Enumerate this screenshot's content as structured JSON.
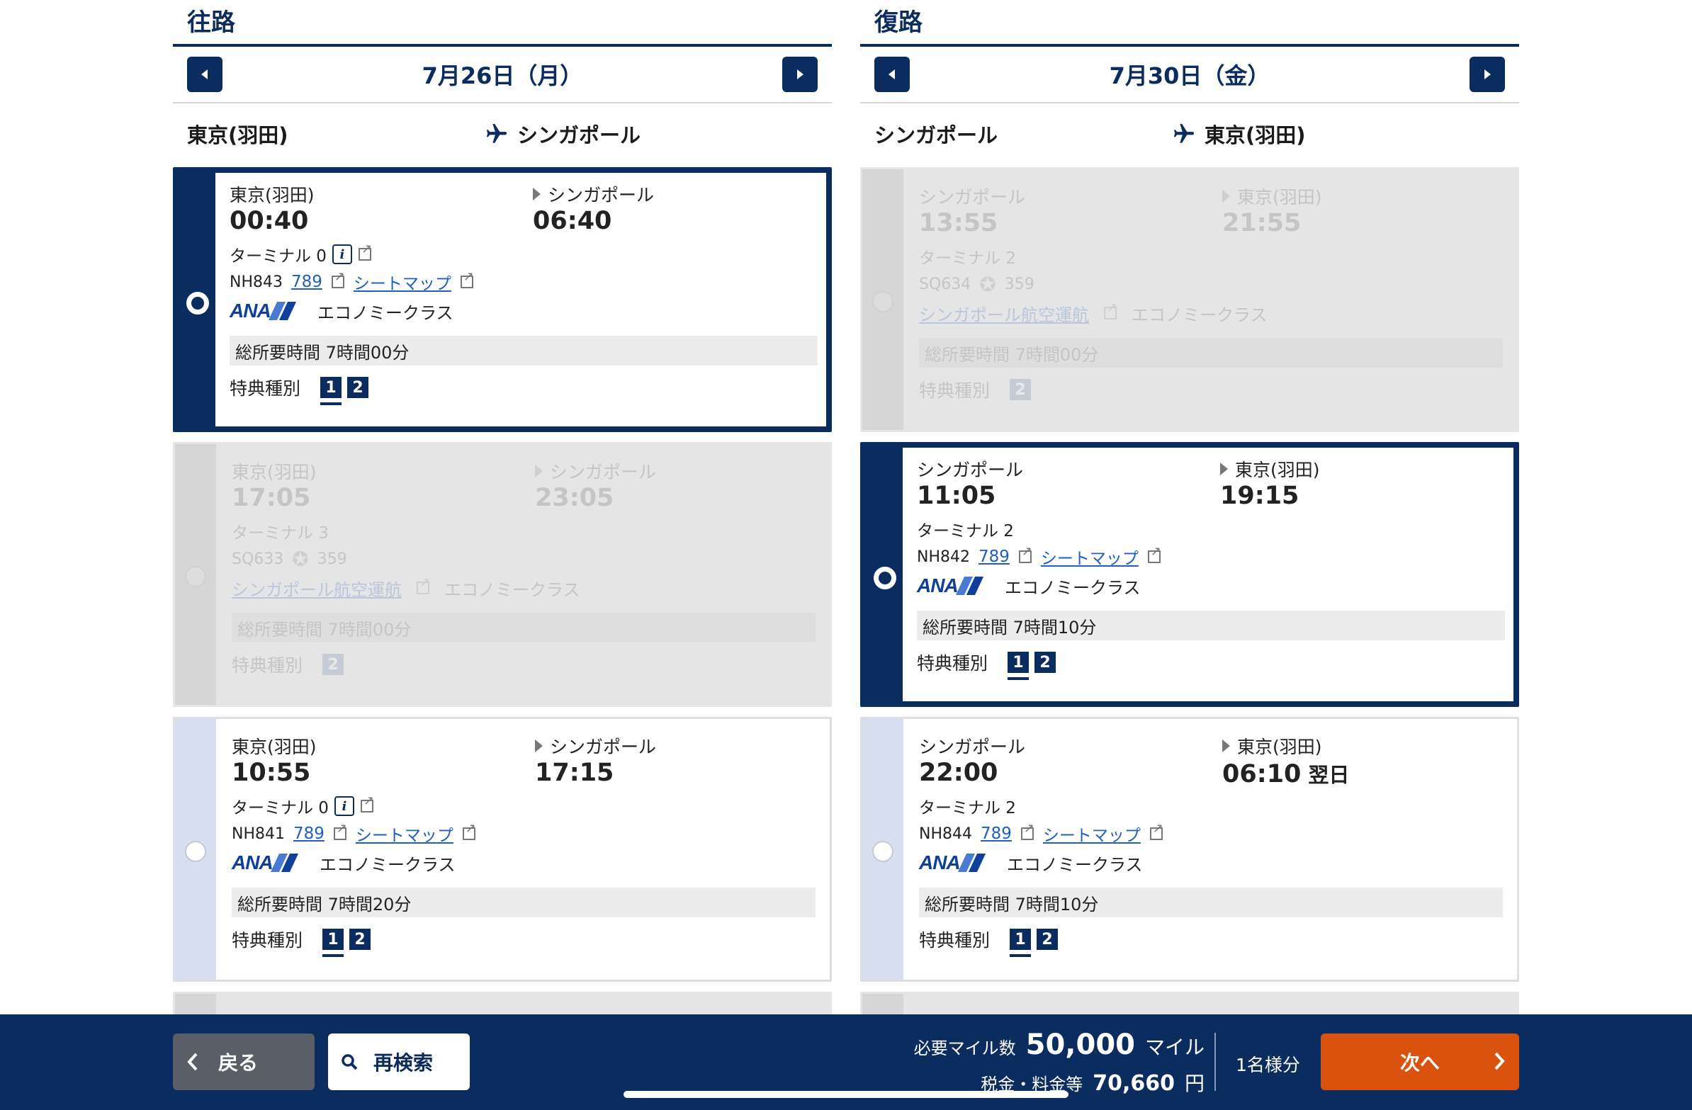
{
  "outbound": {
    "title": "往路",
    "date": "7月26日（月）",
    "from": "東京(羽田)",
    "to": "シンガポール",
    "flights": [
      {
        "dep_city": "東京(羽田)",
        "arr_city": "シンガポール",
        "dep_time": "00:40",
        "arr_time": "06:40",
        "terminal": "ターミナル 0",
        "flight_no": "NH843",
        "aircraft": "789",
        "seat_map": "シートマップ",
        "airline": "ANA",
        "class": "エコノミークラス",
        "duration": "総所要時間 7時間00分",
        "award_label": "特典種別",
        "awards": [
          "1",
          "2"
        ],
        "state": "selected"
      },
      {
        "dep_city": "東京(羽田)",
        "arr_city": "シンガポール",
        "dep_time": "17:05",
        "arr_time": "23:05",
        "terminal": "ターミナル 3",
        "flight_no": "SQ633",
        "aircraft": "359",
        "airline_link": "シンガポール航空運航",
        "class": "エコノミークラス",
        "duration": "総所要時間 7時間00分",
        "award_label": "特典種別",
        "awards": [
          "2"
        ],
        "state": "disabled"
      },
      {
        "dep_city": "東京(羽田)",
        "arr_city": "シンガポール",
        "dep_time": "10:55",
        "arr_time": "17:15",
        "terminal": "ターミナル 0",
        "flight_no": "NH841",
        "aircraft": "789",
        "seat_map": "シートマップ",
        "airline": "ANA",
        "class": "エコノミークラス",
        "duration": "総所要時間 7時間20分",
        "award_label": "特典種別",
        "awards": [
          "1",
          "2"
        ],
        "state": "available"
      }
    ]
  },
  "return": {
    "title": "復路",
    "date": "7月30日（金）",
    "from": "シンガポール",
    "to": "東京(羽田)",
    "flights": [
      {
        "dep_city": "シンガポール",
        "arr_city": "東京(羽田)",
        "dep_time": "13:55",
        "arr_time": "21:55",
        "terminal": "ターミナル 2",
        "flight_no": "SQ634",
        "aircraft": "359",
        "airline_link": "シンガポール航空運航",
        "class": "エコノミークラス",
        "duration": "総所要時間 7時間00分",
        "award_label": "特典種別",
        "awards": [
          "2"
        ],
        "state": "disabled"
      },
      {
        "dep_city": "シンガポール",
        "arr_city": "東京(羽田)",
        "dep_time": "11:05",
        "arr_time": "19:15",
        "terminal": "ターミナル 2",
        "flight_no": "NH842",
        "aircraft": "789",
        "seat_map": "シートマップ",
        "airline": "ANA",
        "class": "エコノミークラス",
        "duration": "総所要時間 7時間10分",
        "award_label": "特典種別",
        "awards": [
          "1",
          "2"
        ],
        "state": "selected"
      },
      {
        "dep_city": "シンガポール",
        "arr_city": "東京(羽田)",
        "dep_time": "22:00",
        "arr_time": "06:10",
        "arr_note": "翌日",
        "terminal": "ターミナル 2",
        "flight_no": "NH844",
        "aircraft": "789",
        "seat_map": "シートマップ",
        "airline": "ANA",
        "class": "エコノミークラス",
        "duration": "総所要時間 7時間10分",
        "award_label": "特典種別",
        "awards": [
          "1",
          "2"
        ],
        "state": "available"
      }
    ]
  },
  "footer": {
    "back_label": "戻る",
    "search_label": "再検索",
    "miles_label": "必要マイル数",
    "miles_value": "50,000",
    "miles_unit": "マイル",
    "tax_label": "税金・料金等",
    "tax_value": "70,660",
    "tax_unit": "円",
    "passengers": "1名様分",
    "next_label": "次へ"
  },
  "colors": {
    "navy": "#0b2c5e",
    "orange": "#d9530f",
    "link": "#1f5fc4"
  }
}
